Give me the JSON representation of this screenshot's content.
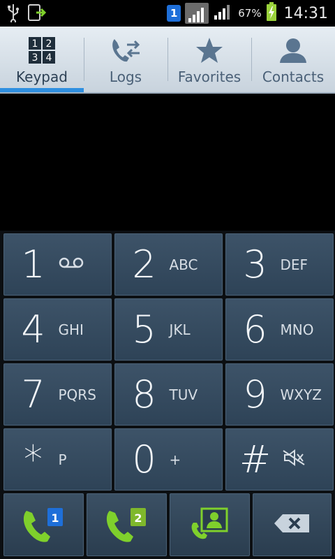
{
  "status_bar": {
    "sim_badge": "1",
    "battery_percent": "67%",
    "time": "14:31",
    "icons": [
      "usb-icon",
      "download-icon",
      "sim1-icon",
      "signal-icon",
      "signal-2-icon",
      "battery-charging-icon"
    ]
  },
  "tabs": [
    {
      "label": "Keypad",
      "icon": "keypad-icon",
      "active": true
    },
    {
      "label": "Logs",
      "icon": "logs-icon",
      "active": false
    },
    {
      "label": "Favorites",
      "icon": "star-icon",
      "active": false
    },
    {
      "label": "Contacts",
      "icon": "contact-icon",
      "active": false
    }
  ],
  "keypad_icon_digits": [
    "1",
    "2",
    "3",
    "4"
  ],
  "keys": [
    {
      "digit": "1",
      "letters": "",
      "extra_icon": "voicemail-icon"
    },
    {
      "digit": "2",
      "letters": "ABC"
    },
    {
      "digit": "3",
      "letters": "DEF"
    },
    {
      "digit": "4",
      "letters": "GHI"
    },
    {
      "digit": "5",
      "letters": "JKL"
    },
    {
      "digit": "6",
      "letters": "MNO"
    },
    {
      "digit": "7",
      "letters": "PQRS"
    },
    {
      "digit": "8",
      "letters": "TUV"
    },
    {
      "digit": "9",
      "letters": "WXYZ"
    },
    {
      "digit": "*",
      "letters": "P"
    },
    {
      "digit": "0",
      "letters": "+"
    },
    {
      "digit": "#",
      "letters": "",
      "extra_icon": "mute-icon"
    }
  ],
  "actions": {
    "call_sim1_badge": "1",
    "call_sim2_badge": "2",
    "icons": [
      "call-sim1-icon",
      "call-sim2-icon",
      "add-contact-icon",
      "backspace-icon"
    ]
  },
  "colors": {
    "accent": "#2f8fe0",
    "call_green": "#7fd02c",
    "key_bg": "#34495d"
  }
}
